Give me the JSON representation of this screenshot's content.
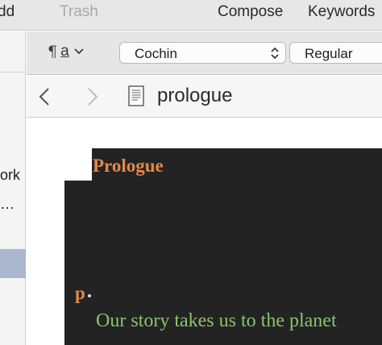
{
  "toolbar": {
    "add_label": "dd",
    "trash_label": "Trash",
    "compose_label": "Compose",
    "keywords_label": "Keywords"
  },
  "sidebar": {
    "item_text_1": "ork",
    "item_text_2": "…"
  },
  "format_bar": {
    "paragraph_style_icon": "pilcrow-icon",
    "paragraph_style_letter": "a",
    "font_family": "Cochin",
    "font_style": "Regular"
  },
  "nav": {
    "document_icon": "document-icon",
    "document_title": "prologue"
  },
  "editor": {
    "heading": "Prologue",
    "paragraph_marker": "p",
    "body_text": "Our story takes us to the planet",
    "colors": {
      "background": "#232323",
      "heading": "#e2884a",
      "body_text": "#88c46b"
    }
  }
}
